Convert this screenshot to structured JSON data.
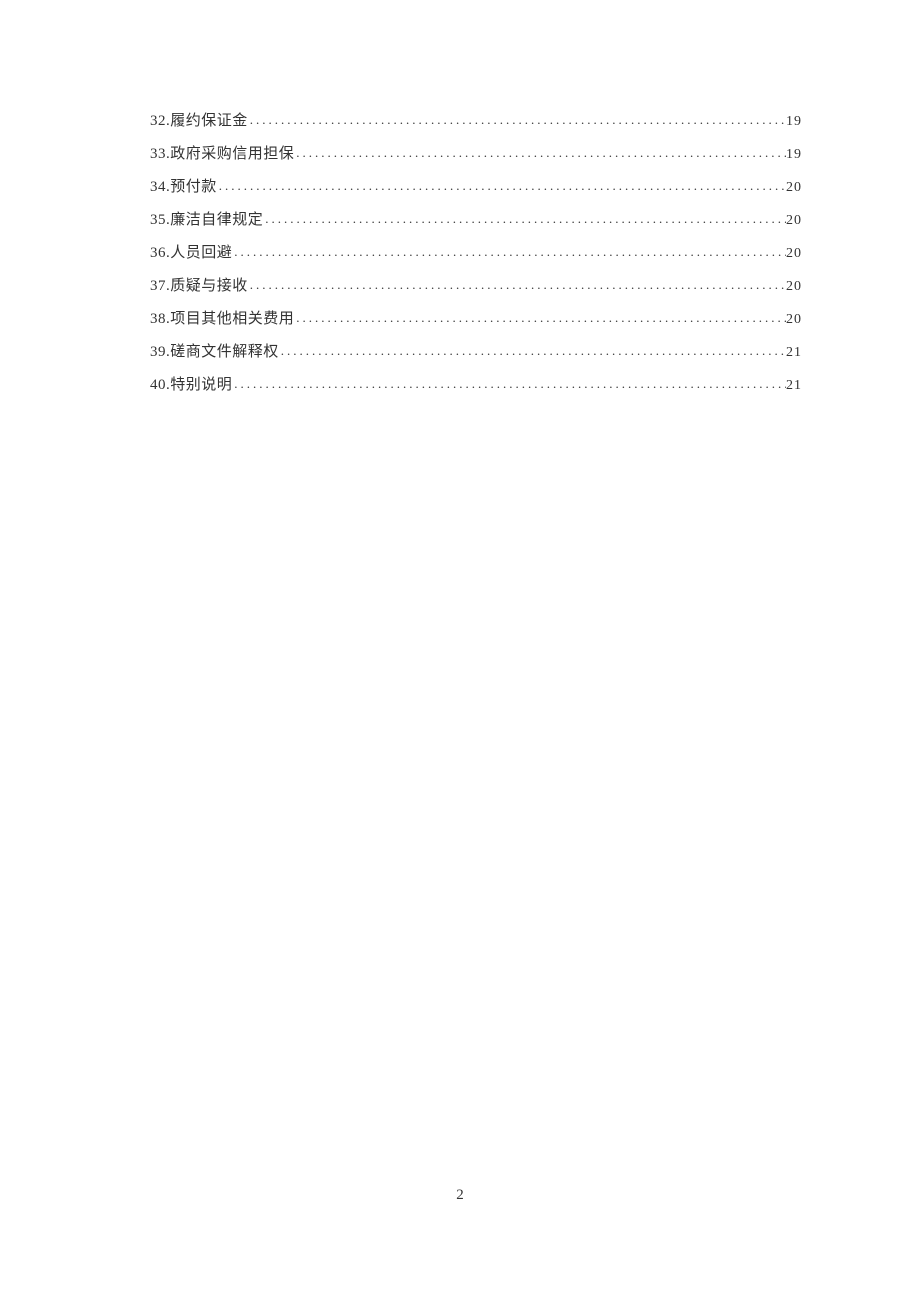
{
  "toc": {
    "entries": [
      {
        "title": "32.履约保证金",
        "page": "19"
      },
      {
        "title": "33.政府采购信用担保",
        "page": "19"
      },
      {
        "title": "34.预付款",
        "page": "20"
      },
      {
        "title": "35.廉洁自律规定",
        "page": "20"
      },
      {
        "title": "36.人员回避",
        "page": "20"
      },
      {
        "title": "37.质疑与接收",
        "page": "20"
      },
      {
        "title": "38.项目其他相关费用",
        "page": "20"
      },
      {
        "title": "39.磋商文件解释权",
        "page": "21"
      },
      {
        "title": "40.特别说明",
        "page": "21"
      }
    ]
  },
  "page_number": "2"
}
